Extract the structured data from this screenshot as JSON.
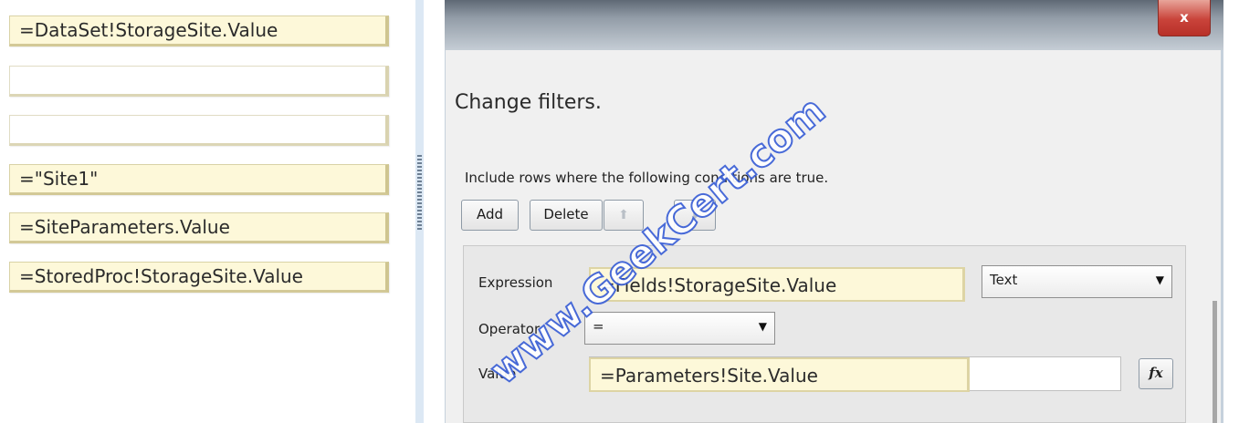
{
  "answer_tiles": [
    "=DataSet!StorageSite.Value",
    "",
    "",
    "=\"Site1\"",
    "=SiteParameters.Value",
    "=StoredProc!StorageSite.Value"
  ],
  "dialog": {
    "close_glyph": "x",
    "heading": "Change filters.",
    "instruction": "Include rows where the following conditions are true.",
    "buttons": {
      "add": "Add",
      "delete": "Delete",
      "move_up_icon": "arrow-up-icon",
      "move_down_icon": "arrow-down-icon"
    },
    "filter": {
      "expression_label": "Expression",
      "expression_value": "=Fields!StorageSite.Value",
      "type_value": "Text",
      "operator_label": "Operator",
      "operator_value": "=",
      "value_label": "Value",
      "value_value": "=Parameters!Site.Value",
      "fx_label": "fx"
    }
  },
  "watermark": "www.GeekCert.com"
}
